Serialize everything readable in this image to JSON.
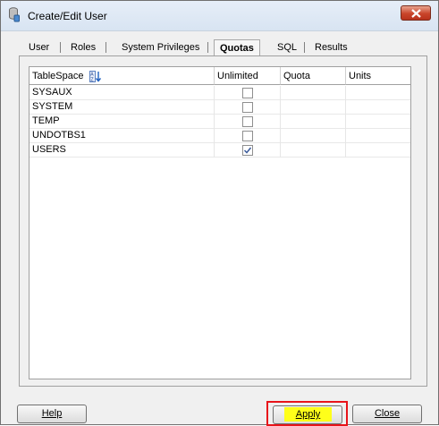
{
  "window": {
    "title": "Create/Edit User",
    "icon": "database-user-icon",
    "close_icon": "close-icon"
  },
  "tabs": [
    {
      "label": "User",
      "active": false
    },
    {
      "label": "Roles",
      "active": false
    },
    {
      "label": "System Privileges",
      "active": false
    },
    {
      "label": "Quotas",
      "active": true
    },
    {
      "label": "SQL",
      "active": false
    },
    {
      "label": "Results",
      "active": false
    }
  ],
  "table": {
    "columns": [
      "TableSpace",
      "Unlimited",
      "Quota",
      "Units"
    ],
    "sort_icon": "sort-az-icon",
    "rows": [
      {
        "tablespace": "SYSAUX",
        "unlimited": false,
        "quota": "",
        "units": ""
      },
      {
        "tablespace": "SYSTEM",
        "unlimited": false,
        "quota": "",
        "units": ""
      },
      {
        "tablespace": "TEMP",
        "unlimited": false,
        "quota": "",
        "units": ""
      },
      {
        "tablespace": "UNDOTBS1",
        "unlimited": false,
        "quota": "",
        "units": ""
      },
      {
        "tablespace": "USERS",
        "unlimited": true,
        "quota": "",
        "units": ""
      }
    ]
  },
  "buttons": {
    "help": "Help",
    "apply": "Apply",
    "close": "Close"
  },
  "colors": {
    "highlight_box": "#e8141a",
    "apply_highlight": "#ffff1a",
    "close_button": "#c9442a"
  }
}
